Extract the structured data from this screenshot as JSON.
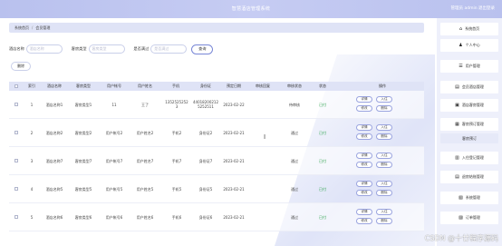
{
  "app": {
    "title": "智慧酒店管理系统",
    "user_info": "管理员 admin  退出登录"
  },
  "breadcrumb": [
    "系统首页",
    "会员管理"
  ],
  "filters": [
    {
      "label": "酒店名称",
      "placeholder": "酒店名称"
    },
    {
      "label": "客房类型",
      "placeholder": "客房类型"
    },
    {
      "label": "是否满过",
      "placeholder": "是否满过"
    }
  ],
  "query_label": "查询",
  "delete_label": "删除",
  "table": {
    "headers": [
      "索引",
      "酒店名称",
      "客房类型",
      "用户帐号",
      "用户姓名",
      "手机",
      "身份证",
      "预定日期",
      "审核回复",
      "审核状态",
      "状态",
      "操作"
    ],
    "rows": [
      {
        "index": "1",
        "hotel": "酒店名称1",
        "room": "客房类型1",
        "account": "11",
        "name": "王了",
        "phone": "13525252523",
        "idcard": "440182002125252511",
        "date": "2023-02-22",
        "reply": "",
        "review": "待审核",
        "status": "已付"
      },
      {
        "index": "2",
        "hotel": "酒店名称2",
        "room": "客房类型2",
        "account": "用户帐号2",
        "name": "用户姓名2",
        "phone": "手机2",
        "idcard": "身份证2",
        "date": "2023-02-21",
        "reply": "",
        "review": "通过",
        "status": "已付"
      },
      {
        "index": "3",
        "hotel": "酒店名称7",
        "room": "客房类型7",
        "account": "用户帐号7",
        "name": "用户姓名7",
        "phone": "手机7",
        "idcard": "身份证7",
        "date": "2023-02-21",
        "reply": "",
        "review": "通过",
        "status": "已付"
      },
      {
        "index": "4",
        "hotel": "酒店名称5",
        "room": "客房类型5",
        "account": "用户帐号5",
        "name": "用户姓名5",
        "phone": "手机5",
        "idcard": "身份证5",
        "date": "2023-02-21",
        "reply": "",
        "review": "通过",
        "status": "已付"
      },
      {
        "index": "5",
        "hotel": "酒店名称6",
        "room": "客房类型6",
        "account": "用户帐号6",
        "name": "用户姓名6",
        "phone": "手机6",
        "idcard": "身份证6",
        "date": "2023-02-21",
        "reply": "",
        "review": "通过",
        "status": "已付"
      }
    ],
    "actions": [
      "详情",
      "入住",
      "修改",
      "删除"
    ]
  },
  "sidebar": [
    {
      "icon": "⌂",
      "label": "系统首页"
    },
    {
      "icon": "♟",
      "label": "个人中心"
    },
    {
      "icon": "☰",
      "label": "用户管理"
    },
    {
      "icon": "▤",
      "label": "会员酒店管理"
    },
    {
      "icon": "▣",
      "label": "酒店客房管理"
    },
    {
      "icon": "▦",
      "label": "客房预订管理"
    },
    {
      "icon": "",
      "label": "客房预订"
    },
    {
      "icon": "▥",
      "label": "入住登记管理"
    },
    {
      "icon": "▤",
      "label": "退房结账管理"
    },
    {
      "icon": "▧",
      "label": "系统管理"
    },
    {
      "icon": "▨",
      "label": "订单管理"
    }
  ],
  "watermark": "CSDN @十廿程序源码",
  "colors": {
    "accent": "#7887d6",
    "header": "#c6ccf3",
    "status_ok": "#2aa24a"
  }
}
